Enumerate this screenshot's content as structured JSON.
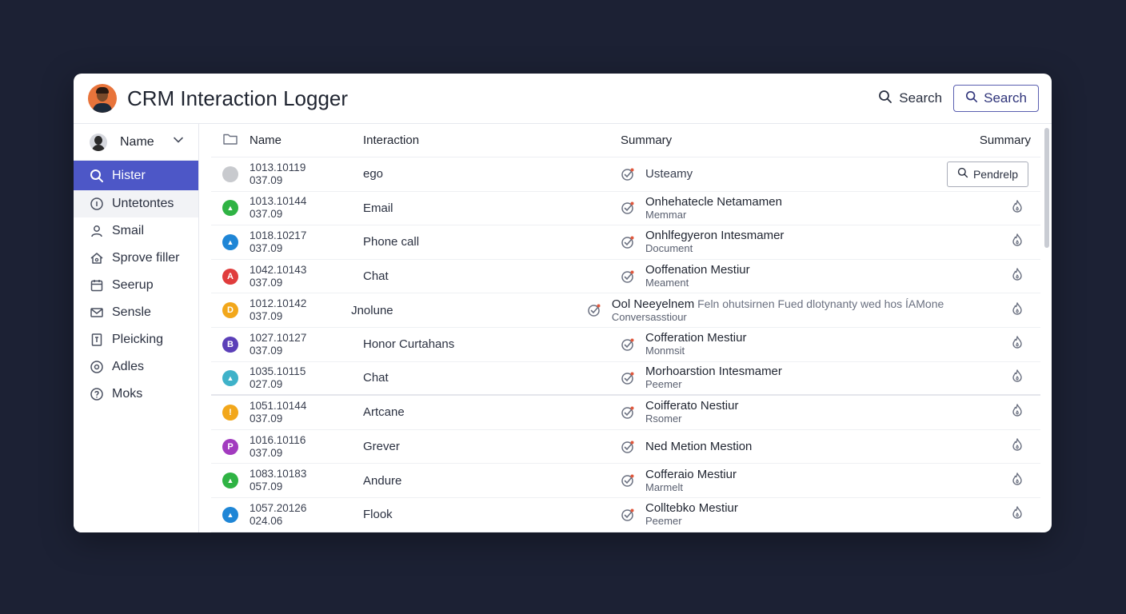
{
  "app": {
    "title": "CRM Interaction Logger"
  },
  "header": {
    "search_link": "Search",
    "search_button": "Search"
  },
  "sidebar": {
    "header_label": "Name",
    "items": [
      {
        "label": "Hister",
        "icon": "search-icon"
      },
      {
        "label": "Untetontes",
        "icon": "info-circle-icon"
      },
      {
        "label": "Smail",
        "icon": "person-icon"
      },
      {
        "label": "Sprove filler",
        "icon": "home-icon"
      },
      {
        "label": "Seerup",
        "icon": "calendar-icon"
      },
      {
        "label": "Sensle",
        "icon": "mail-icon"
      },
      {
        "label": "Pleicking",
        "icon": "document-icon"
      },
      {
        "label": "Adles",
        "icon": "target-icon"
      },
      {
        "label": "Moks",
        "icon": "help-circle-icon"
      }
    ]
  },
  "table": {
    "columns": {
      "name": "Name",
      "interaction": "Interaction",
      "summary": "Summary",
      "action": "Summary"
    },
    "action_button": "Pendrelp",
    "rows": [
      {
        "id": "1013.10119",
        "date": "037.09",
        "dot_color": "#c8cace",
        "dot_glyph": "",
        "interaction": "ego",
        "title": "Usteamy",
        "extra": "",
        "sub": ""
      },
      {
        "id": "1013.10144",
        "date": "037.09",
        "dot_color": "#2fb344",
        "dot_glyph": "▲",
        "interaction": "Email",
        "title": "Onhehatecle Netamamen",
        "extra": "",
        "sub": "Memmar"
      },
      {
        "id": "1018.10217",
        "date": "037.09",
        "dot_color": "#1f86d6",
        "dot_glyph": "▲",
        "interaction": "Phone call",
        "title": "Onhlfegyeron Intesmamer",
        "extra": "",
        "sub": "Document"
      },
      {
        "id": "1042.10143",
        "date": "037.09",
        "dot_color": "#e03c3c",
        "dot_glyph": "A",
        "interaction": "Chat",
        "title": "Ooffenation Mestiur",
        "extra": "",
        "sub": "Meament"
      },
      {
        "id": "1012.10142",
        "date": "037.09",
        "dot_color": "#f2a71b",
        "dot_glyph": "D",
        "interaction": "Jnolune",
        "title": "Ool Neeyelnem",
        "extra": "Feln ohutsirnen Fued dlotynanty wed hos ÍAMone",
        "sub": "Conversasstiour"
      },
      {
        "id": "1027.10127",
        "date": "037.09",
        "dot_color": "#5b3fb8",
        "dot_glyph": "B",
        "interaction": "Honor Curtahans",
        "title": "Cofferation Mestiur",
        "extra": "",
        "sub": "Monmsit"
      },
      {
        "id": "1035.10115",
        "date": "027.09",
        "dot_color": "#3fb2c9",
        "dot_glyph": "▲",
        "interaction": "Chat",
        "title": "Morhoarstion Intesmamer",
        "extra": "",
        "sub": "Peemer"
      },
      {
        "id": "1051.10144",
        "date": "037.09",
        "dot_color": "#f2a71b",
        "dot_glyph": "!",
        "interaction": "Artcane",
        "title": "Coifferato Nestiur",
        "extra": "",
        "sub": "Rsomer"
      },
      {
        "id": "1016.10116",
        "date": "037.09",
        "dot_color": "#a23bbf",
        "dot_glyph": "P",
        "interaction": "Grever",
        "title": "Ned Metion Mestion",
        "extra": "",
        "sub": ""
      },
      {
        "id": "1083.10183",
        "date": "057.09",
        "dot_color": "#2fb344",
        "dot_glyph": "▲",
        "interaction": "Andure",
        "title": "Cofferaio Mestiur",
        "extra": "",
        "sub": "Marmelt"
      },
      {
        "id": "1057.20126",
        "date": "024.06",
        "dot_color": "#1f86d6",
        "dot_glyph": "▲",
        "interaction": "Flook",
        "title": "Colltebko Mestiur",
        "extra": "",
        "sub": "Peemer"
      }
    ]
  }
}
